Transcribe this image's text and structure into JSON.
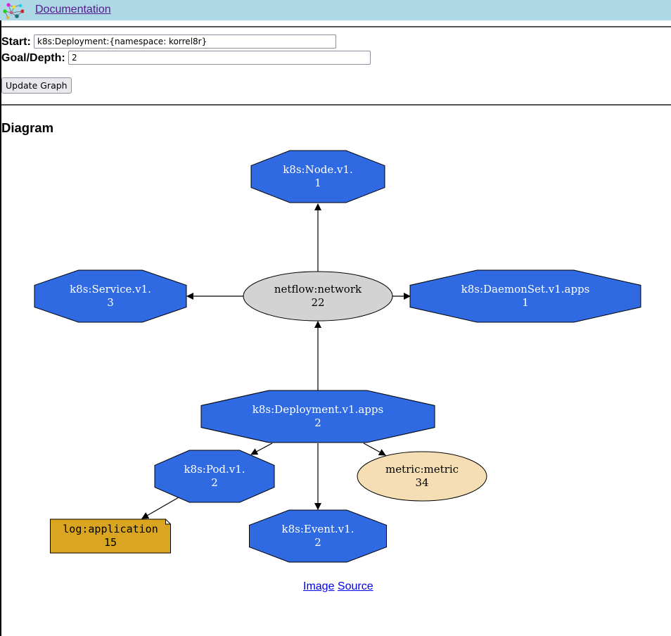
{
  "header": {
    "logo_icon": "graph-network-icon",
    "documentation_link": "Documentation",
    "background_color": "#add8e6"
  },
  "form": {
    "start_label": "Start:",
    "start_value": "k8s:Deployment:{namespace: korrel8r}",
    "goal_label": "Goal/Depth:",
    "goal_value": "2",
    "update_button": "Update Graph"
  },
  "diagram": {
    "title": "Diagram",
    "nodes": [
      {
        "id": "node",
        "label": "k8s:Node.v1.",
        "count": "1",
        "shape": "octagon",
        "fill": "#306ae3"
      },
      {
        "id": "service",
        "label": "k8s:Service.v1.",
        "count": "3",
        "shape": "octagon",
        "fill": "#306ae3"
      },
      {
        "id": "netflow",
        "label": "netflow:network",
        "count": "22",
        "shape": "ellipse",
        "fill": "#d3d3d3"
      },
      {
        "id": "daemonset",
        "label": "k8s:DaemonSet.v1.apps",
        "count": "1",
        "shape": "octagon",
        "fill": "#306ae3"
      },
      {
        "id": "deployment",
        "label": "k8s:Deployment.v1.apps",
        "count": "2",
        "shape": "octagon",
        "fill": "#306ae3"
      },
      {
        "id": "pod",
        "label": "k8s:Pod.v1.",
        "count": "2",
        "shape": "octagon",
        "fill": "#306ae3"
      },
      {
        "id": "metric",
        "label": "metric:metric",
        "count": "34",
        "shape": "ellipse",
        "fill": "#f5deb3"
      },
      {
        "id": "log",
        "label": "log:application",
        "count": "15",
        "shape": "note",
        "fill": "#daa520"
      },
      {
        "id": "event",
        "label": "k8s:Event.v1.",
        "count": "2",
        "shape": "octagon",
        "fill": "#306ae3"
      }
    ],
    "edges": [
      {
        "from": "netflow",
        "to": "node"
      },
      {
        "from": "netflow",
        "to": "service"
      },
      {
        "from": "netflow",
        "to": "daemonset"
      },
      {
        "from": "deployment",
        "to": "netflow"
      },
      {
        "from": "deployment",
        "to": "pod"
      },
      {
        "from": "deployment",
        "to": "event"
      },
      {
        "from": "deployment",
        "to": "metric"
      },
      {
        "from": "pod",
        "to": "log"
      }
    ]
  },
  "footer": {
    "image_link": "Image",
    "source_link": "Source"
  }
}
